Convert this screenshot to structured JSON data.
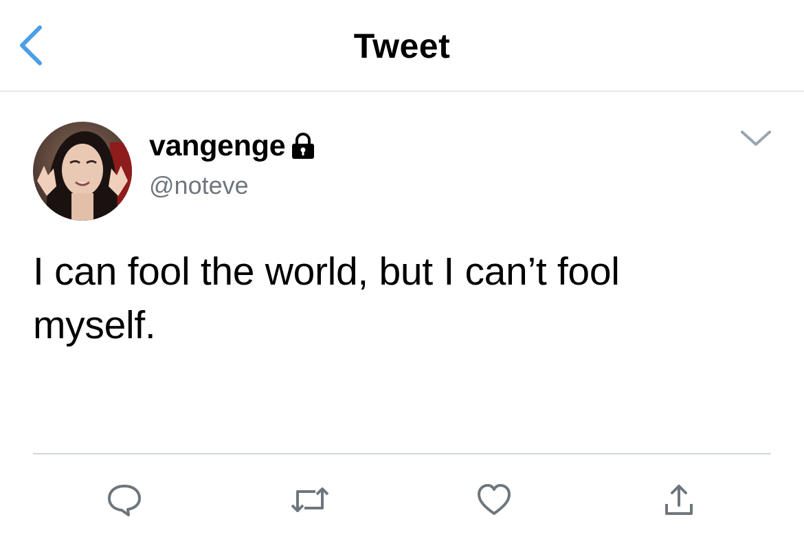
{
  "header": {
    "title": "Tweet",
    "back_icon": "chevron-left-icon",
    "accent": "#4a9ee6"
  },
  "tweet": {
    "author": {
      "display_name": "vangenge",
      "handle": "@noteve",
      "protected_icon": "lock-icon"
    },
    "text_line1": "I can fool the world, but I can’t fool",
    "text_line2": "myself.",
    "menu_icon": "chevron-down-icon"
  },
  "actions": [
    {
      "name": "reply",
      "icon": "speech-bubble-icon"
    },
    {
      "name": "retweet",
      "icon": "retweet-icon"
    },
    {
      "name": "like",
      "icon": "heart-icon"
    },
    {
      "name": "share",
      "icon": "share-icon"
    }
  ],
  "colors": {
    "text": "#000000",
    "secondary": "#6e767d",
    "divider": "#cfd6dc",
    "icon": "#6e767d"
  }
}
